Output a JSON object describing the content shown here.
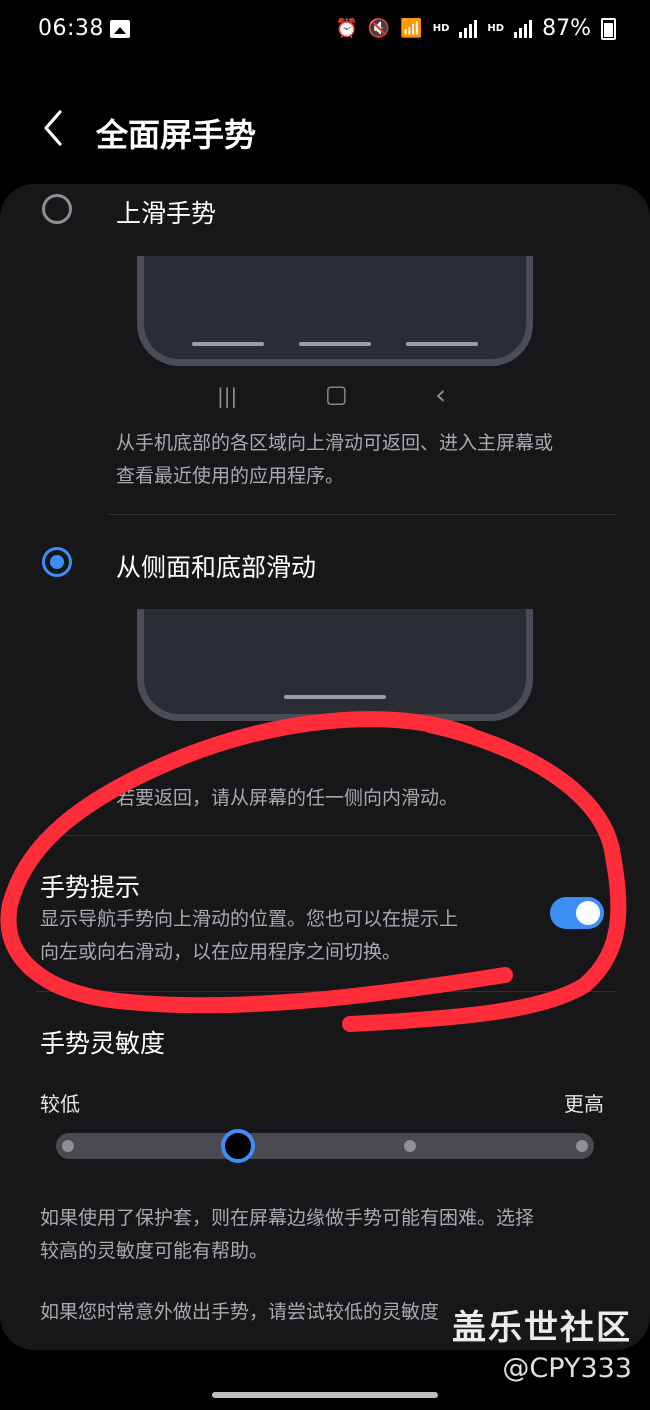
{
  "status_bar": {
    "time": "06:38",
    "hd_1": "HD",
    "hd_2": "HD",
    "battery": "87%",
    "icons": [
      "gallery-icon",
      "alarm-icon",
      "mute-icon",
      "wifi-icon",
      "signal-icon",
      "battery-icon"
    ]
  },
  "header": {
    "title": "全面屏手势",
    "back_icon": "chevron-left-icon"
  },
  "options": [
    {
      "label": "上滑手势",
      "selected": false,
      "description_1": "从手机底部的各区域向上滑动可返回、进入主屏幕或",
      "description_2": "查看最近使用的应用程序。"
    },
    {
      "label": "从侧面和底部滑动",
      "selected": true,
      "description": "若要返回，请从屏幕的任一侧向内滑动。"
    }
  ],
  "nav_keys": {
    "recents": "|||",
    "home": "▢",
    "back": "‹"
  },
  "gesture_hint": {
    "title": "手势提示",
    "description_1": "显示导航手势向上滑动的位置。您也可以在提示上",
    "description_2": "向左或向右滑动，以在应用程序之间切换。",
    "enabled": true
  },
  "sensitivity": {
    "title": "手势灵敏度",
    "low_label": "较低",
    "high_label": "更高",
    "levels": 4,
    "current_level": 2,
    "note_1a": "如果使用了保护套，则在屏幕边缘做手势可能有困难。选择",
    "note_1b": "较高的灵敏度可能有帮助。",
    "note_2": "如果您时常意外做出手势，请尝试较低的灵敏度"
  },
  "watermark": {
    "logo": "盖乐世社区",
    "handle": "@CPY333"
  },
  "colors": {
    "accent": "#3e8ef7",
    "card": "#17171a",
    "annotation": "#ff2d3a"
  }
}
